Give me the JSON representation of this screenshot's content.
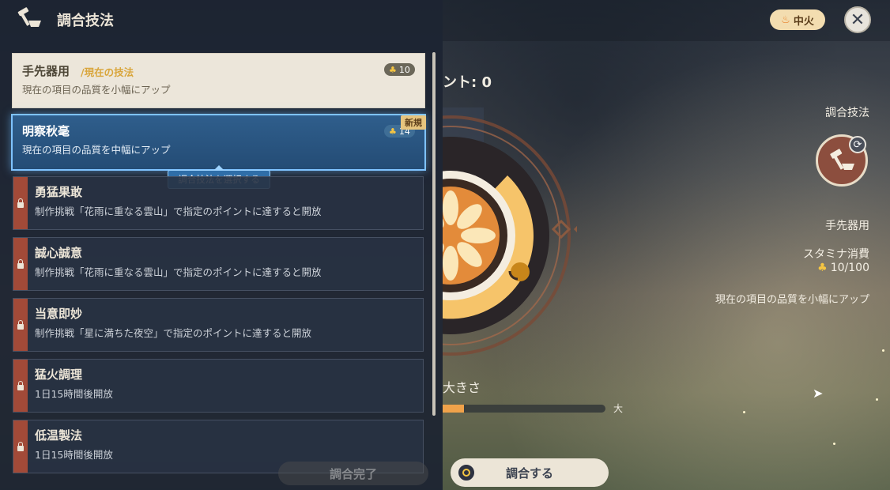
{
  "panel": {
    "title": "調合技法",
    "current_technique": {
      "name": "手先器用",
      "tag": "/現在の技法",
      "cost": "10",
      "description": "現在の項目の品質を小幅にアップ"
    },
    "selected_technique": {
      "name": "明察秋毫",
      "cost": "14",
      "badge": "新規",
      "description": "現在の項目の品質を中幅にアップ"
    },
    "tooltip": "調合技法を選択する",
    "locked_techniques": [
      {
        "name": "勇猛果敢",
        "condition": "制作挑戦「花雨に重なる雲山」で指定のポイントに達すると開放"
      },
      {
        "name": "誠心誠意",
        "condition": "制作挑戦「花雨に重なる雲山」で指定のポイントに達すると開放"
      },
      {
        "name": "当意即妙",
        "condition": "制作挑戦「星に満ちた夜空」で指定のポイントに達すると開放"
      },
      {
        "name": "猛火調理",
        "condition": "1日15時間後開放"
      },
      {
        "name": "低温製法",
        "condition": "1日15時間後開放"
      }
    ],
    "done_button": "調合完了"
  },
  "scene": {
    "heat_badge": "中火",
    "points_label": "ント: 0",
    "size_label": "大きさ",
    "size_max_label": "大",
    "size_progress": 0.13,
    "blend_button": "調合する"
  },
  "right_panel": {
    "title": "調合技法",
    "technique_name": "手先器用",
    "stamina_label": "スタミナ消費",
    "stamina_value": "10/100",
    "description": "現在の項目の品質を小幅にアップ"
  },
  "icons": {
    "coin": "stamina-coin-icon",
    "close": "close-icon",
    "lock": "lock-icon",
    "flame": "flame-icon",
    "refresh": "refresh-icon",
    "hammer": "hammer-pot-icon"
  },
  "colors": {
    "accent_gold": "#f5c542",
    "selected_blue": "#2f5e8c",
    "lock_red": "#a24a38",
    "dial_orange": "#f6c46a"
  }
}
